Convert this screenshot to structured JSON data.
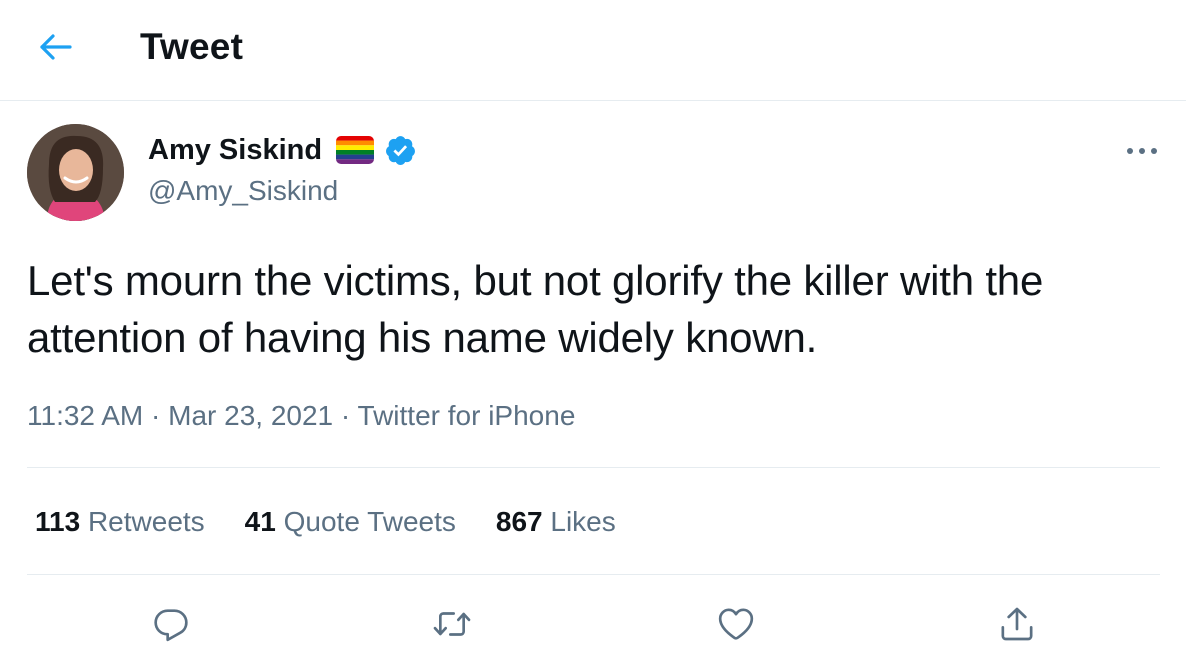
{
  "header": {
    "back_icon": "arrow-left-icon",
    "title": "Tweet"
  },
  "author": {
    "name": "Amy Siskind",
    "handle": "@Amy_Siskind",
    "badges": [
      "rainbow-flag-icon",
      "verified-badge-icon"
    ]
  },
  "tweet": {
    "text": "Let's mourn the victims, but not glorify the killer with the attention of having his name widely known.",
    "time": "11:32 AM",
    "date": "Mar 23, 2021",
    "source": "Twitter for iPhone",
    "separator": "·"
  },
  "stats": {
    "retweets": {
      "count": "113",
      "label": "Retweets"
    },
    "quotes": {
      "count": "41",
      "label": "Quote Tweets"
    },
    "likes": {
      "count": "867",
      "label": "Likes"
    }
  },
  "actions": [
    "reply-icon",
    "retweet-icon",
    "like-icon",
    "share-icon"
  ],
  "colors": {
    "accent": "#1da1f2",
    "text": "#0f1419",
    "secondary_text": "#5b7083",
    "divider": "#e6ecf0"
  }
}
